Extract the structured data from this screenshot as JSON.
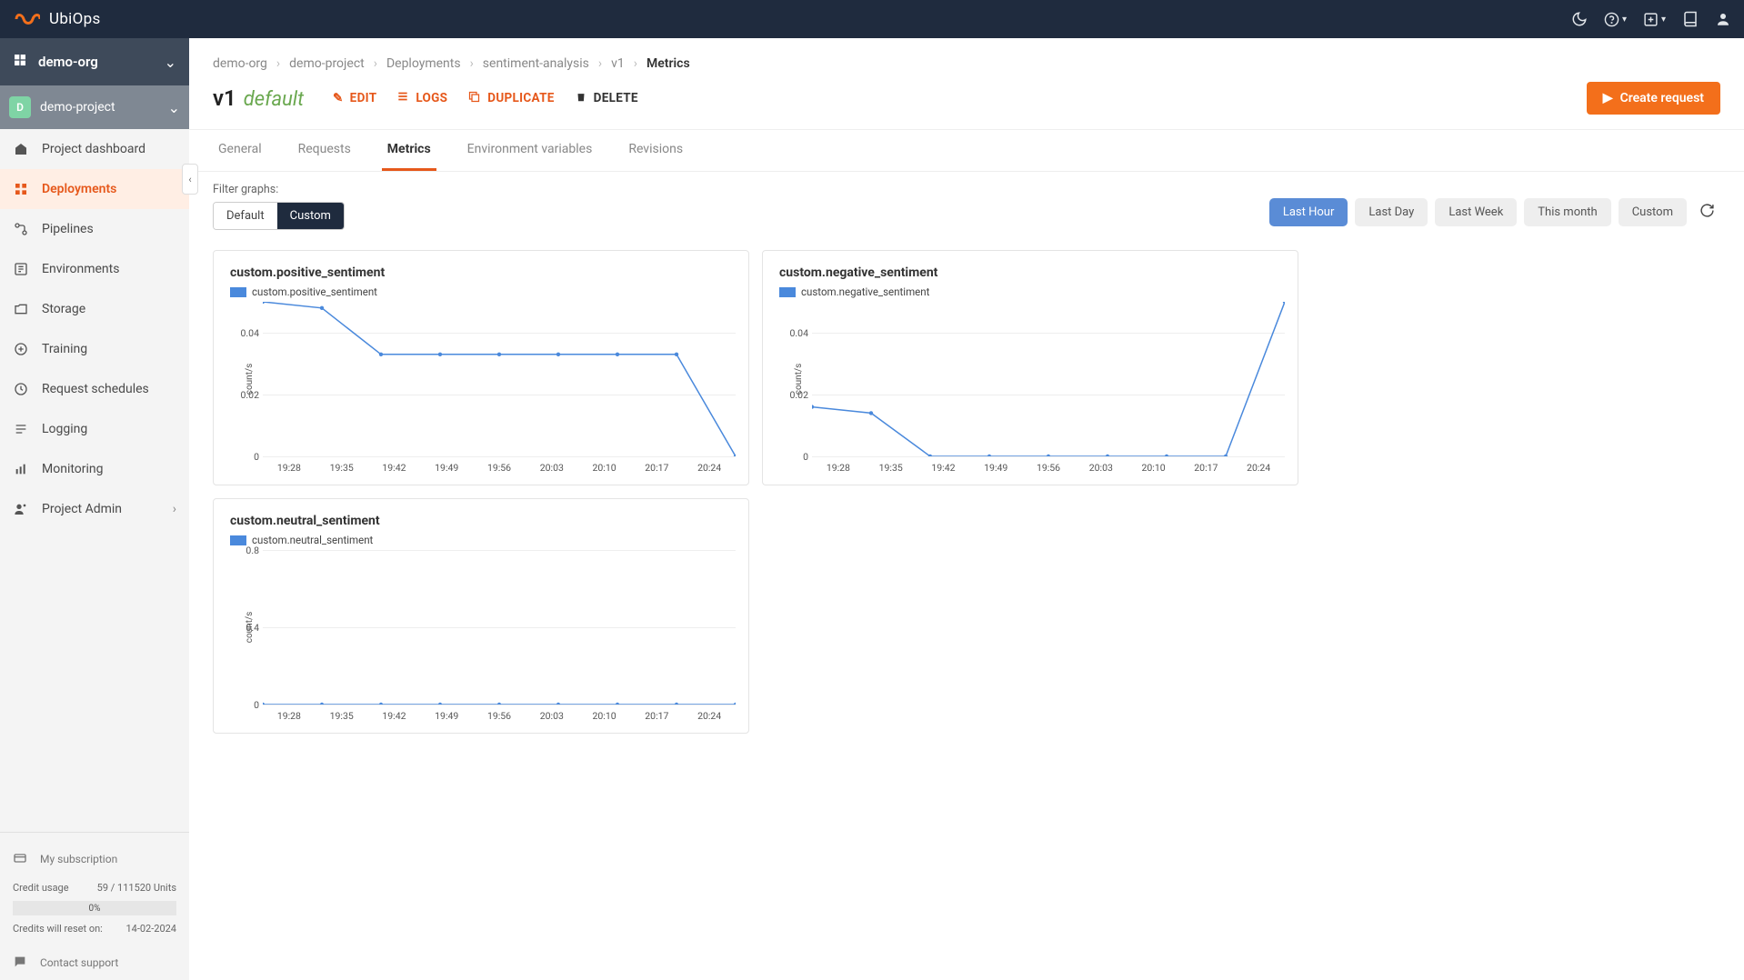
{
  "brand": "UbiOps",
  "org": {
    "name": "demo-org"
  },
  "project": {
    "initial": "D",
    "name": "demo-project"
  },
  "sidebar": {
    "items": [
      {
        "label": "Project dashboard"
      },
      {
        "label": "Deployments"
      },
      {
        "label": "Pipelines"
      },
      {
        "label": "Environments"
      },
      {
        "label": "Storage"
      },
      {
        "label": "Training"
      },
      {
        "label": "Request schedules"
      },
      {
        "label": "Logging"
      },
      {
        "label": "Monitoring"
      },
      {
        "label": "Project Admin"
      }
    ],
    "subscription_label": "My subscription",
    "credit_usage_label": "Credit usage",
    "credit_usage_value": "59 / 111520 Units",
    "credit_pct": "0%",
    "credit_reset_label": "Credits will reset on:",
    "credit_reset_value": "14-02-2024",
    "contact_label": "Contact support"
  },
  "breadcrumb": [
    "demo-org",
    "demo-project",
    "Deployments",
    "sentiment-analysis",
    "v1",
    "Metrics"
  ],
  "title": {
    "version": "v1",
    "tag": "default"
  },
  "actions": {
    "edit": "EDIT",
    "logs": "LOGS",
    "duplicate": "DUPLICATE",
    "delete": "DELETE",
    "create": "Create request"
  },
  "tabs": [
    "General",
    "Requests",
    "Metrics",
    "Environment variables",
    "Revisions"
  ],
  "active_tab": "Metrics",
  "filter_label": "Filter graphs:",
  "filter_seg": {
    "default": "Default",
    "custom": "Custom"
  },
  "ranges": [
    "Last Hour",
    "Last Day",
    "Last Week",
    "This month",
    "Custom"
  ],
  "active_range": "Last Hour",
  "chart_data": [
    {
      "title": "custom.positive_sentiment",
      "legend": "custom.positive_sentiment",
      "type": "line",
      "ylabel": "count/s",
      "ylim": [
        0,
        0.05
      ],
      "yticks": [
        0,
        0.02,
        0.04
      ],
      "x": [
        "19:28",
        "19:35",
        "19:42",
        "19:49",
        "19:56",
        "20:03",
        "20:10",
        "20:17",
        "20:24"
      ],
      "values": [
        0.05,
        0.048,
        0.033,
        0.033,
        0.033,
        0.033,
        0.033,
        0.033,
        0.0
      ]
    },
    {
      "title": "custom.negative_sentiment",
      "legend": "custom.negative_sentiment",
      "type": "line",
      "ylabel": "count/s",
      "ylim": [
        0,
        0.05
      ],
      "yticks": [
        0,
        0.02,
        0.04
      ],
      "x": [
        "19:28",
        "19:35",
        "19:42",
        "19:49",
        "19:56",
        "20:03",
        "20:10",
        "20:17",
        "20:24"
      ],
      "values": [
        0.016,
        0.014,
        0.0,
        0.0,
        0.0,
        0.0,
        0.0,
        0.0,
        0.05
      ]
    },
    {
      "title": "custom.neutral_sentiment",
      "legend": "custom.neutral_sentiment",
      "type": "line",
      "ylabel": "count/s",
      "ylim": [
        0,
        0.8
      ],
      "yticks": [
        0,
        0.4,
        0.8
      ],
      "x": [
        "19:28",
        "19:35",
        "19:42",
        "19:49",
        "19:56",
        "20:03",
        "20:10",
        "20:17",
        "20:24"
      ],
      "values": [
        0.0,
        0.0,
        0.0,
        0.0,
        0.0,
        0.0,
        0.0,
        0.0,
        0.0
      ]
    }
  ]
}
